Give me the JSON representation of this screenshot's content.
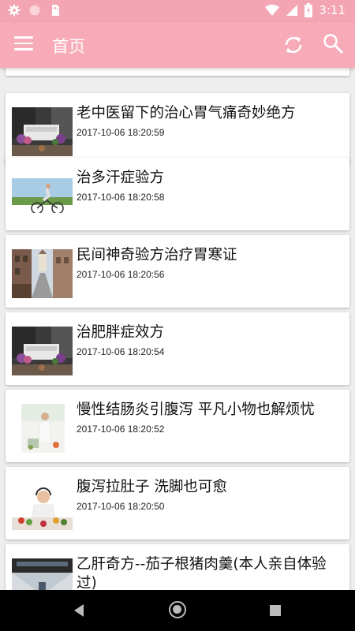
{
  "status_bar": {
    "time": "3:11",
    "icons": [
      "gear-icon",
      "circle-icon",
      "sim-card-icon",
      "wifi-icon",
      "signal-icon",
      "battery-icon"
    ]
  },
  "app_bar": {
    "title": "首页",
    "icons": [
      "menu-icon",
      "refresh-icon",
      "search-icon"
    ]
  },
  "articles": [
    {
      "title": "老中医留下的治心胃气痛奇妙绝方",
      "time": "2017-10-06 18:20:59",
      "thumb": "bench-flowers"
    },
    {
      "title": "治多汗症验方",
      "time": "2017-10-06 18:20:58",
      "thumb": "woman-bicycle"
    },
    {
      "title": "民间神奇验方治疗胃寒证",
      "time": "2017-10-06 18:20:56",
      "thumb": "old-town-street"
    },
    {
      "title": "治肥胖症效方",
      "time": "2017-10-06 18:20:54",
      "thumb": "bench-flowers"
    },
    {
      "title": "慢性结肠炎引腹泻 平凡小物也解烦忧",
      "time": "2017-10-06 18:20:52",
      "thumb": "woman-kitchen"
    },
    {
      "title": "腹泻拉肚子 洗脚也可愈",
      "time": "2017-10-06 18:20:50",
      "thumb": "woman-vegetables"
    },
    {
      "title": "乙肝奇方--茄子根猪肉羹(本人亲自体验过)",
      "time": "",
      "thumb": "train-station"
    }
  ],
  "nav_bar": {
    "icons": [
      "back-icon",
      "home-icon",
      "recents-icon"
    ]
  },
  "colors": {
    "primary": "#f7aab8",
    "status_bar": "#f3a5b4",
    "background": "#eeeeee"
  }
}
